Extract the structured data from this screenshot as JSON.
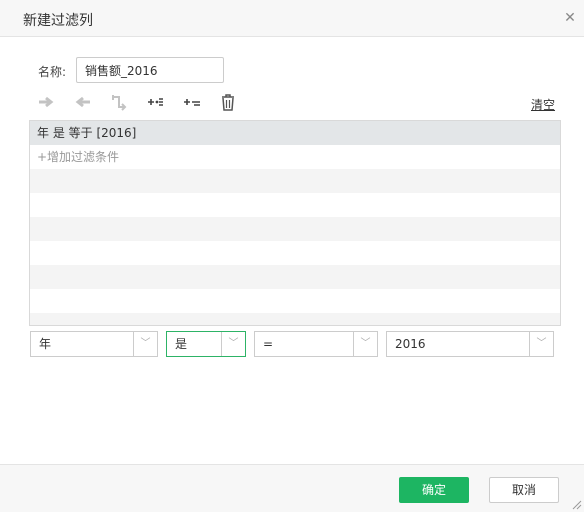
{
  "dialog": {
    "title": "新建过滤列",
    "close_glyph": "✕"
  },
  "name_field": {
    "label": "名称:",
    "value": "销售额_2016"
  },
  "toolbar": {
    "icons": [
      "arrow-right-icon",
      "arrow-left-icon",
      "return-icon",
      "add-condition-icon",
      "add-group-icon",
      "trash-icon"
    ],
    "clear_label": "清空"
  },
  "filter_list": {
    "selected_condition": "年 是 等于 [2016]",
    "add_condition_label": "+增加过滤条件"
  },
  "condition_editor": {
    "field": "年",
    "operator_is": "是",
    "comparison": "=",
    "value": "2016"
  },
  "footer": {
    "ok_label": "确定",
    "cancel_label": "取消"
  },
  "colors": {
    "accent": "#1db562",
    "selected_row": "#e3e6e8"
  }
}
